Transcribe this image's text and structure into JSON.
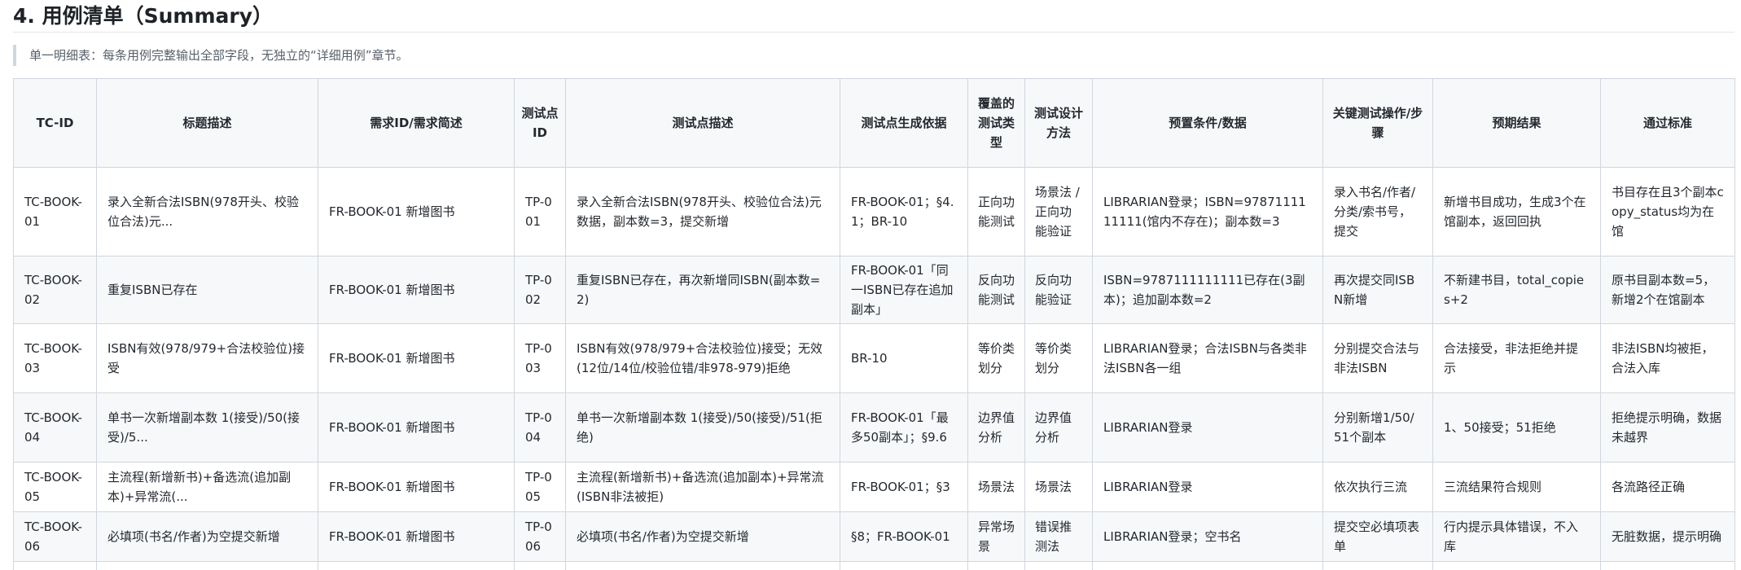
{
  "heading": "4. 用例清单（Summary）",
  "note": "单一明细表：每条用例完整输出全部字段，无独立的“详细用例”章节。",
  "columns": [
    "TC-ID",
    "标题描述",
    "需求ID/需求简述",
    "测试点ID",
    "测试点描述",
    "测试点生成依据",
    "覆盖的测试类型",
    "测试设计方法",
    "预置条件/数据",
    "关键测试操作/步骤",
    "预期结果",
    "通过标准"
  ],
  "rows": [
    {
      "tc_id": "TC-BOOK-01",
      "title": "录入全新合法ISBN(978开头、校验位合法)元...",
      "req": "FR-BOOK-01 新增图书",
      "tp_id": "TP-001",
      "tp_desc": "录入全新合法ISBN(978开头、校验位合法)元数据，副本数=3，提交新增",
      "basis": "FR-BOOK-01；§4.1；BR-10",
      "type": "正向功能测试",
      "method": "场景法 / 正向功能验证",
      "precond": "LIBRARIAN登录；ISBN=9787111111111(馆内不存在)；副本数=3",
      "steps": "录入书名/作者/分类/索书号，提交",
      "expected": "新增书目成功，生成3个在馆副本，返回回执",
      "criteria": "书目存在且3个副本copy_status均为在馆"
    },
    {
      "tc_id": "TC-BOOK-02",
      "title": "重复ISBN已存在",
      "req": "FR-BOOK-01 新增图书",
      "tp_id": "TP-002",
      "tp_desc": "重复ISBN已存在，再次新增同ISBN(副本数=2)",
      "basis": "FR-BOOK-01「同一ISBN已存在追加副本」",
      "type": "反向功能测试",
      "method": "反向功能验证",
      "precond": "ISBN=9787111111111已存在(3副本)；追加副本数=2",
      "steps": "再次提交同ISBN新增",
      "expected": "不新建书目，total_copies+2",
      "criteria": "原书目副本数=5，新增2个在馆副本"
    },
    {
      "tc_id": "TC-BOOK-03",
      "title": "ISBN有效(978/979+合法校验位)接受",
      "req": "FR-BOOK-01 新增图书",
      "tp_id": "TP-003",
      "tp_desc": "ISBN有效(978/979+合法校验位)接受；无效(12位/14位/校验位错/非978-979)拒绝",
      "basis": "BR-10",
      "type": "等价类划分",
      "method": "等价类划分",
      "precond": "LIBRARIAN登录；合法ISBN与各类非法ISBN各一组",
      "steps": "分别提交合法与非法ISBN",
      "expected": "合法接受，非法拒绝并提示",
      "criteria": "非法ISBN均被拒，合法入库"
    },
    {
      "tc_id": "TC-BOOK-04",
      "title": "单书一次新增副本数 1(接受)/50(接受)/5...",
      "req": "FR-BOOK-01 新增图书",
      "tp_id": "TP-004",
      "tp_desc": "单书一次新增副本数 1(接受)/50(接受)/51(拒绝)",
      "basis": "FR-BOOK-01「最多50副本」；§9.6",
      "type": "边界值分析",
      "method": "边界值分析",
      "precond": "LIBRARIAN登录",
      "steps": "分别新增1/50/51个副本",
      "expected": "1、50接受；51拒绝",
      "criteria": "拒绝提示明确，数据未越界"
    },
    {
      "tc_id": "TC-BOOK-05",
      "title": "主流程(新增新书)+备选流(追加副本)+异常流(...",
      "req": "FR-BOOK-01 新增图书",
      "tp_id": "TP-005",
      "tp_desc": "主流程(新增新书)+备选流(追加副本)+异常流(ISBN非法被拒)",
      "basis": "FR-BOOK-01；§3",
      "type": "场景法",
      "method": "场景法",
      "precond": "LIBRARIAN登录",
      "steps": "依次执行三流",
      "expected": "三流结果符合规则",
      "criteria": "各流路径正确"
    },
    {
      "tc_id": "TC-BOOK-06",
      "title": "必填项(书名/作者)为空提交新增",
      "req": "FR-BOOK-01 新增图书",
      "tp_id": "TP-006",
      "tp_desc": "必填项(书名/作者)为空提交新增",
      "basis": "§8；FR-BOOK-01",
      "type": "异常场景",
      "method": "错误推测法",
      "precond": "LIBRARIAN登录；空书名",
      "steps": "提交空必填项表单",
      "expected": "行内提示具体错误，不入库",
      "criteria": "无脏数据，提示明确"
    },
    {
      "tc_id": "",
      "title": "",
      "req": "",
      "tp_id": "",
      "tp_desc": "",
      "basis": "",
      "type": "",
      "method": "",
      "precond": "",
      "steps": "",
      "expected": "",
      "criteria": ""
    }
  ]
}
